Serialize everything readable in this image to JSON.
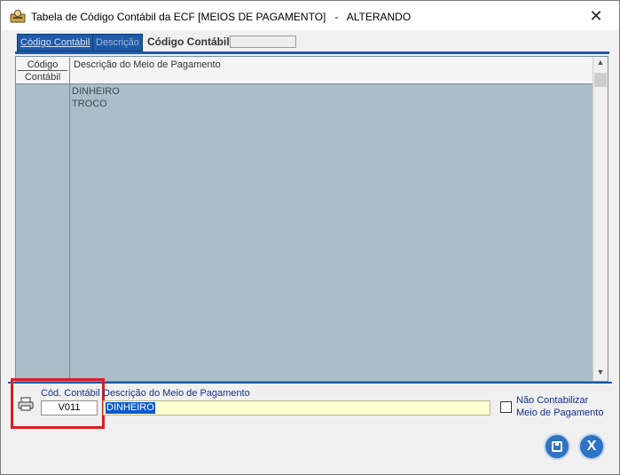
{
  "window": {
    "title": "Tabela de Código Contábil da ECF [MEIOS DE PAGAMENTO]   -   ALTERANDO",
    "close_glyph": "✕"
  },
  "tabs": [
    {
      "label": "Código Contábil",
      "active": true
    },
    {
      "label": "Descrição",
      "active": false
    }
  ],
  "search": {
    "label": "Código Contábil:",
    "value": ""
  },
  "grid": {
    "columns": [
      {
        "line1": "Código",
        "line2": "Contábil"
      },
      {
        "label": "Descrição do Meio de Pagamento"
      }
    ],
    "rows": [
      {
        "codigo": "",
        "descricao": "DINHEIRO"
      },
      {
        "codigo": "",
        "descricao": "TROCO"
      }
    ],
    "scroll_up_glyph": "▲",
    "scroll_down_glyph": "▼"
  },
  "edit": {
    "cod_label": "Cód. Contábil",
    "cod_value": "V011",
    "desc_label": "Descrição do Meio de Pagamento",
    "desc_value": "DINHEIRO",
    "checkbox_label_line1": "Não Contabilizar",
    "checkbox_label_line2": "Meio de Pagamento",
    "checkbox_checked": false
  },
  "footer": {
    "close_glyph": "X"
  },
  "colors": {
    "accent": "#1f5aa8",
    "grid_bg": "#a9bec8",
    "highlight": "#e21b23",
    "input_yellow": "#fdfdd2"
  },
  "icons": [
    "app-icon",
    "close-icon",
    "printer-icon",
    "save-icon",
    "exit-icon"
  ]
}
